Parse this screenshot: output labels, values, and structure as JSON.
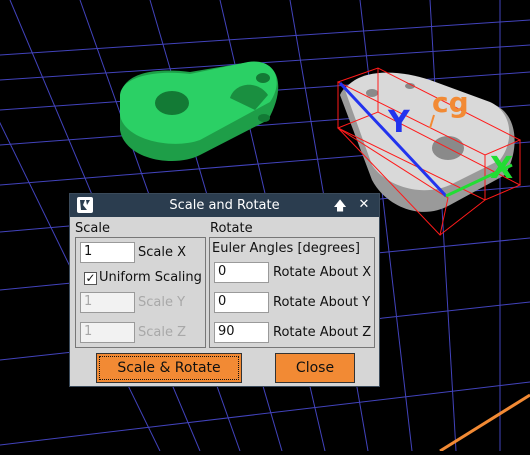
{
  "viewport": {
    "background": "#000000",
    "grid_color": "#4a4bd1",
    "part_colors": {
      "scaled_part": "#22c25b",
      "selected_part": "#cfcfcf",
      "bounding_box": "#ff1a1a"
    },
    "axis_labels": {
      "y": "Y",
      "x": "X",
      "cg": "cg"
    },
    "axis_colors": {
      "y": "#2233ee",
      "x": "#22dd33",
      "cg": "#f28a34"
    }
  },
  "dialog": {
    "title": "Scale and Rotate",
    "titlebar_buttons": {
      "maximize": "🡅",
      "close": "✕"
    },
    "scale": {
      "heading": "Scale",
      "scale_x": {
        "value": "1",
        "label": "Scale X"
      },
      "uniform_scaling": {
        "label": "Uniform Scaling",
        "checked": true,
        "mark": "✓"
      },
      "scale_y": {
        "value": "1",
        "label": "Scale Y",
        "enabled": false
      },
      "scale_z": {
        "value": "1",
        "label": "Scale Z",
        "enabled": false
      }
    },
    "rotate": {
      "heading": "Rotate",
      "euler_label": "Euler Angles [degrees]",
      "rotate_x": {
        "value": "0",
        "label": "Rotate About X"
      },
      "rotate_y": {
        "value": "0",
        "label": "Rotate About Y"
      },
      "rotate_z": {
        "value": "90",
        "label": "Rotate About Z"
      }
    },
    "buttons": {
      "apply": "Scale & Rotate",
      "close": "Close"
    },
    "accent": "#f28a34"
  }
}
